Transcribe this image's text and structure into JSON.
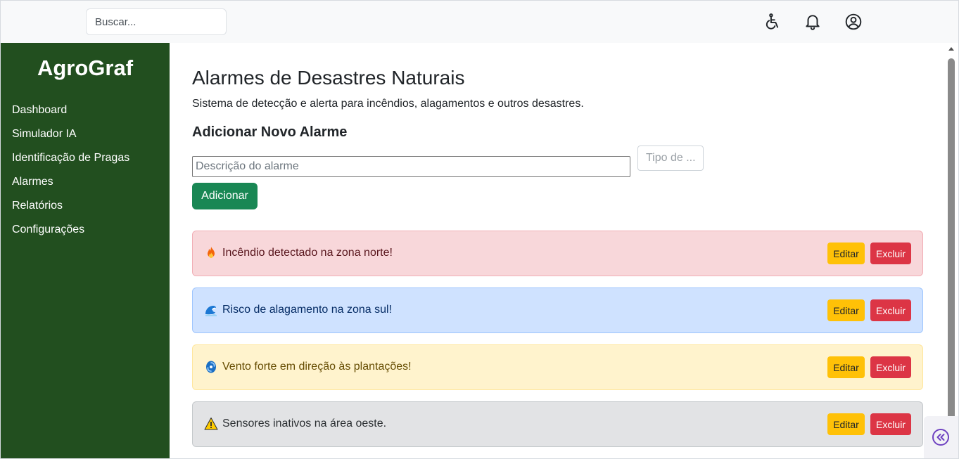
{
  "topbar": {
    "search_placeholder": "Buscar...",
    "icons": [
      "accessibility-icon",
      "bell-icon",
      "user-circle-icon"
    ]
  },
  "sidebar": {
    "brand": "AgroGraf",
    "items": [
      {
        "label": "Dashboard"
      },
      {
        "label": "Simulador IA"
      },
      {
        "label": "Identificação de Pragas"
      },
      {
        "label": "Alarmes"
      },
      {
        "label": "Relatórios"
      },
      {
        "label": "Configurações"
      }
    ]
  },
  "main": {
    "title": "Alarmes de Desastres Naturais",
    "subtitle": "Sistema de detecção e alerta para incêndios, alagamentos e outros desastres.",
    "form": {
      "section_title": "Adicionar Novo Alarme",
      "description_placeholder": "Descrição do alarme",
      "type_placeholder": "Tipo de ...",
      "add_label": "Adicionar"
    },
    "alarms": [
      {
        "icon": "fire-icon",
        "text": "Incêndio detectado na zona norte!",
        "variant": "danger"
      },
      {
        "icon": "wave-icon",
        "text": "Risco de alagamento na zona sul!",
        "variant": "info"
      },
      {
        "icon": "cyclone-icon",
        "text": "Vento forte em direção às plantações!",
        "variant": "warning"
      },
      {
        "icon": "warning-icon",
        "text": "Sensores inativos na área oeste.",
        "variant": "secondary"
      }
    ],
    "edit_label": "Editar",
    "delete_label": "Excluir"
  },
  "colors": {
    "sidebar_bg": "#224f1f",
    "primary_button": "#198754",
    "edit_button": "#ffc107",
    "delete_button": "#dc3545"
  }
}
